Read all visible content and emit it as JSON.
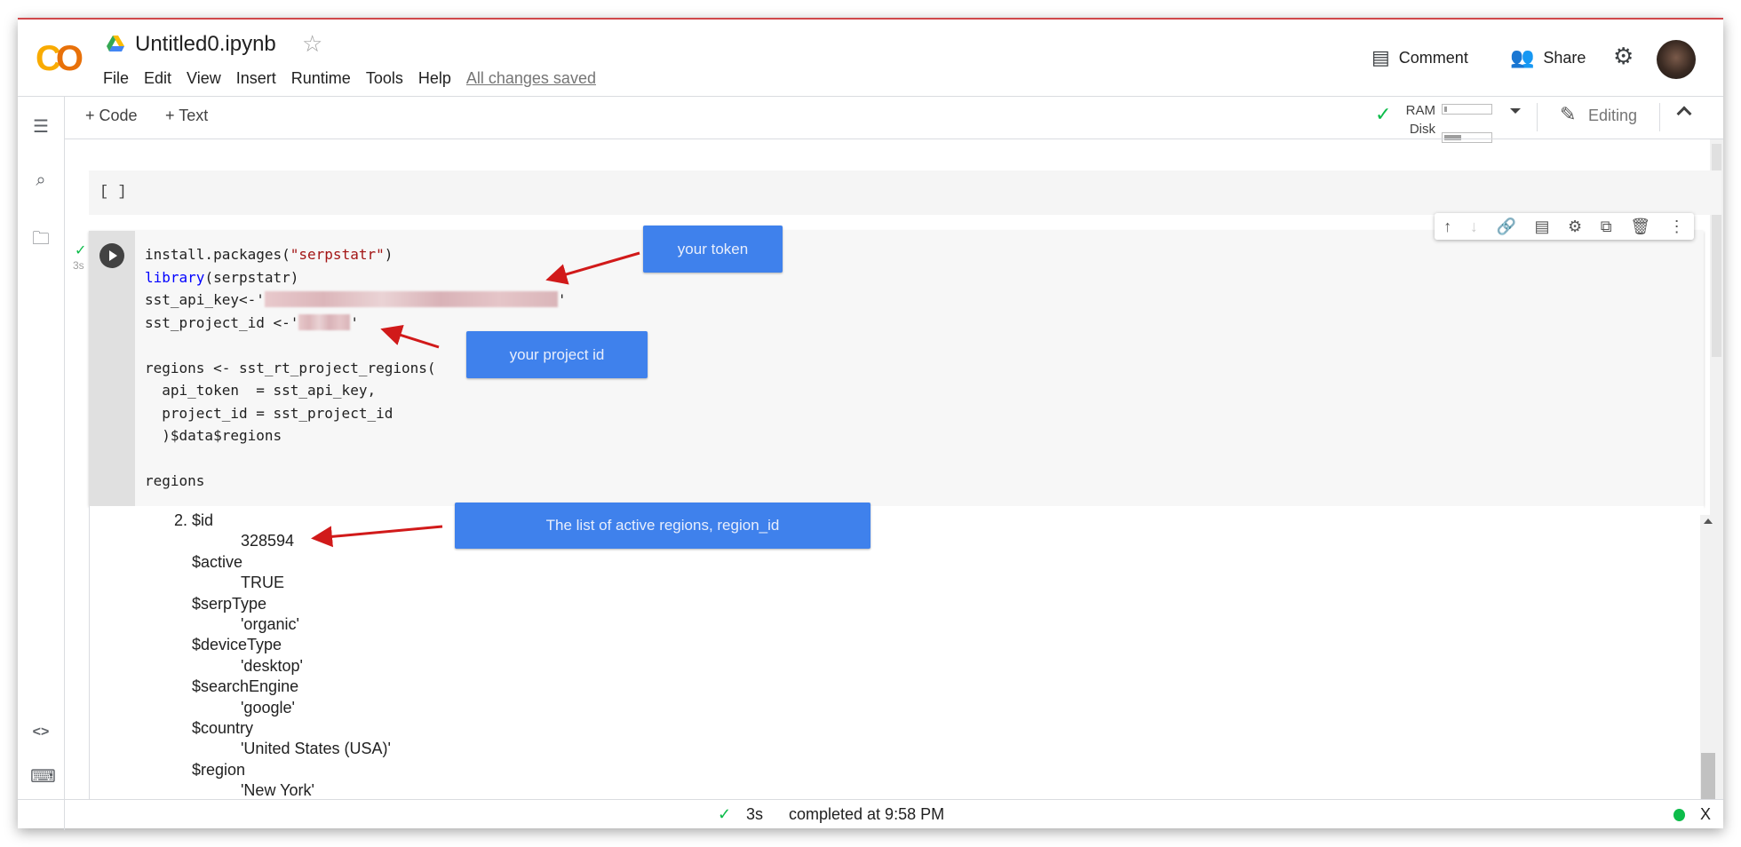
{
  "header": {
    "logo": "CO",
    "title": "Untitled0.ipynb",
    "menu": [
      "File",
      "Edit",
      "View",
      "Insert",
      "Runtime",
      "Tools",
      "Help"
    ],
    "save_status": "All changes saved",
    "comment": "Comment",
    "share": "Share"
  },
  "toolbar": {
    "add_code": "+ Code",
    "add_text": "+ Text",
    "ram": "RAM",
    "disk": "Disk",
    "ram_usage": 0.05,
    "disk_usage": 0.35,
    "editing": "Editing"
  },
  "empty_cell": {
    "prompt": "[ ]"
  },
  "code_cell": {
    "exec_time": "3s",
    "lines": {
      "l0a": "install.packages(",
      "l0b": "\"serpstatr\"",
      "l0c": ")",
      "l1a": "library",
      "l1b": "(serpstatr)",
      "l2a": "sst_api_key<-'",
      "l2b": "'",
      "l3a": "sst_project_id <-'",
      "l3b": "'",
      "l5": "regions <- sst_rt_project_regions(",
      "l6": "  api_token  = sst_api_key,",
      "l7": "  project_id = sst_project_id",
      "l8": "  )$data$regions",
      "l10": "regions"
    }
  },
  "output": [
    {
      "text": "2. $id",
      "indent": 0
    },
    {
      "text": "328594",
      "indent": 2
    },
    {
      "text": "$active",
      "indent": 1
    },
    {
      "text": "TRUE",
      "indent": 2
    },
    {
      "text": "$serpType",
      "indent": 1
    },
    {
      "text": "'organic'",
      "indent": 2
    },
    {
      "text": "$deviceType",
      "indent": 1
    },
    {
      "text": "'desktop'",
      "indent": 2
    },
    {
      "text": "$searchEngine",
      "indent": 1
    },
    {
      "text": "'google'",
      "indent": 2
    },
    {
      "text": "$country",
      "indent": 1
    },
    {
      "text": "'United States (USA)'",
      "indent": 2
    },
    {
      "text": "$region",
      "indent": 1
    },
    {
      "text": "'New York'",
      "indent": 2
    }
  ],
  "callouts": {
    "token": "your token",
    "project": "your project id",
    "regions": "The list of active regions, region_id"
  },
  "status": {
    "duration": "3s",
    "completed": "completed at 9:58 PM",
    "close": "X"
  },
  "colors": {
    "accent": "#3f81ec",
    "arrow": "#d11a1a",
    "ok": "#0dbc4a",
    "string": "#a31515",
    "keyword": "#0000ff"
  }
}
